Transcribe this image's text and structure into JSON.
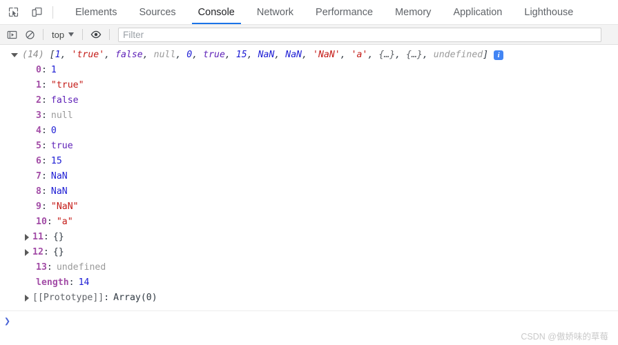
{
  "toolbar_top": {
    "icons": [
      {
        "name": "inspect-element-icon",
        "title": "Inspect element"
      },
      {
        "name": "device-toolbar-icon",
        "title": "Toggle device toolbar"
      }
    ],
    "tabs": [
      {
        "label": "Elements",
        "active": false
      },
      {
        "label": "Sources",
        "active": false
      },
      {
        "label": "Console",
        "active": true
      },
      {
        "label": "Network",
        "active": false
      },
      {
        "label": "Performance",
        "active": false
      },
      {
        "label": "Memory",
        "active": false
      },
      {
        "label": "Application",
        "active": false
      },
      {
        "label": "Lighthouse",
        "active": false
      }
    ],
    "active_tab_underline_color": "#1a73e8"
  },
  "filterbar": {
    "sidebar_toggle_name": "console-sidebar-icon",
    "clear_console_name": "clear-console-icon",
    "context_selected": "top",
    "eye_icon_name": "live-expression-eye-icon",
    "filter_placeholder": "Filter",
    "filter_value": ""
  },
  "console": {
    "entry": {
      "expanded": true,
      "count_label": "(14)",
      "preview": {
        "open": "[",
        "close": "]",
        "items": [
          {
            "text": "1",
            "cls": "num"
          },
          {
            "text": "'true'",
            "cls": "str"
          },
          {
            "text": "false",
            "cls": "bool"
          },
          {
            "text": "null",
            "cls": "nul"
          },
          {
            "text": "0",
            "cls": "num"
          },
          {
            "text": "true",
            "cls": "bool"
          },
          {
            "text": "15",
            "cls": "num"
          },
          {
            "text": "NaN",
            "cls": "num"
          },
          {
            "text": "NaN",
            "cls": "num"
          },
          {
            "text": "'NaN'",
            "cls": "str"
          },
          {
            "text": "'a'",
            "cls": "str"
          },
          {
            "text": "{…}",
            "cls": "objbr"
          },
          {
            "text": "{…}",
            "cls": "objbr"
          },
          {
            "text": "undefined",
            "cls": "undef"
          }
        ]
      },
      "info_badge": "i",
      "properties": [
        {
          "key": "0",
          "key_cls": "key",
          "value": "1",
          "value_cls": "num",
          "expandable": false
        },
        {
          "key": "1",
          "key_cls": "key",
          "value": "\"true\"",
          "value_cls": "str",
          "expandable": false
        },
        {
          "key": "2",
          "key_cls": "key",
          "value": "false",
          "value_cls": "bool",
          "expandable": false
        },
        {
          "key": "3",
          "key_cls": "key",
          "value": "null",
          "value_cls": "nul",
          "expandable": false
        },
        {
          "key": "4",
          "key_cls": "key",
          "value": "0",
          "value_cls": "num",
          "expandable": false
        },
        {
          "key": "5",
          "key_cls": "key",
          "value": "true",
          "value_cls": "bool",
          "expandable": false
        },
        {
          "key": "6",
          "key_cls": "key",
          "value": "15",
          "value_cls": "num",
          "expandable": false
        },
        {
          "key": "7",
          "key_cls": "key",
          "value": "NaN",
          "value_cls": "num",
          "expandable": false
        },
        {
          "key": "8",
          "key_cls": "key",
          "value": "NaN",
          "value_cls": "num",
          "expandable": false
        },
        {
          "key": "9",
          "key_cls": "key",
          "value": "\"NaN\"",
          "value_cls": "str",
          "expandable": false
        },
        {
          "key": "10",
          "key_cls": "key",
          "value": "\"a\"",
          "value_cls": "str",
          "expandable": false
        },
        {
          "key": "11",
          "key_cls": "key",
          "value": "{}",
          "value_cls": "val-plain",
          "expandable": true
        },
        {
          "key": "12",
          "key_cls": "key",
          "value": "{}",
          "value_cls": "val-plain",
          "expandable": true
        },
        {
          "key": "13",
          "key_cls": "key",
          "value": "undefined",
          "value_cls": "undef",
          "expandable": false
        },
        {
          "key": "length",
          "key_cls": "key",
          "value": "14",
          "value_cls": "num",
          "expandable": false
        },
        {
          "key": "[[Prototype]]",
          "key_cls": "key-plain",
          "value": "Array(0)",
          "value_cls": "val-plain",
          "expandable": true
        }
      ]
    }
  },
  "prompt": {
    "chevron": "❯",
    "value": ""
  },
  "watermark": "CSDN @傲娇味的草莓"
}
